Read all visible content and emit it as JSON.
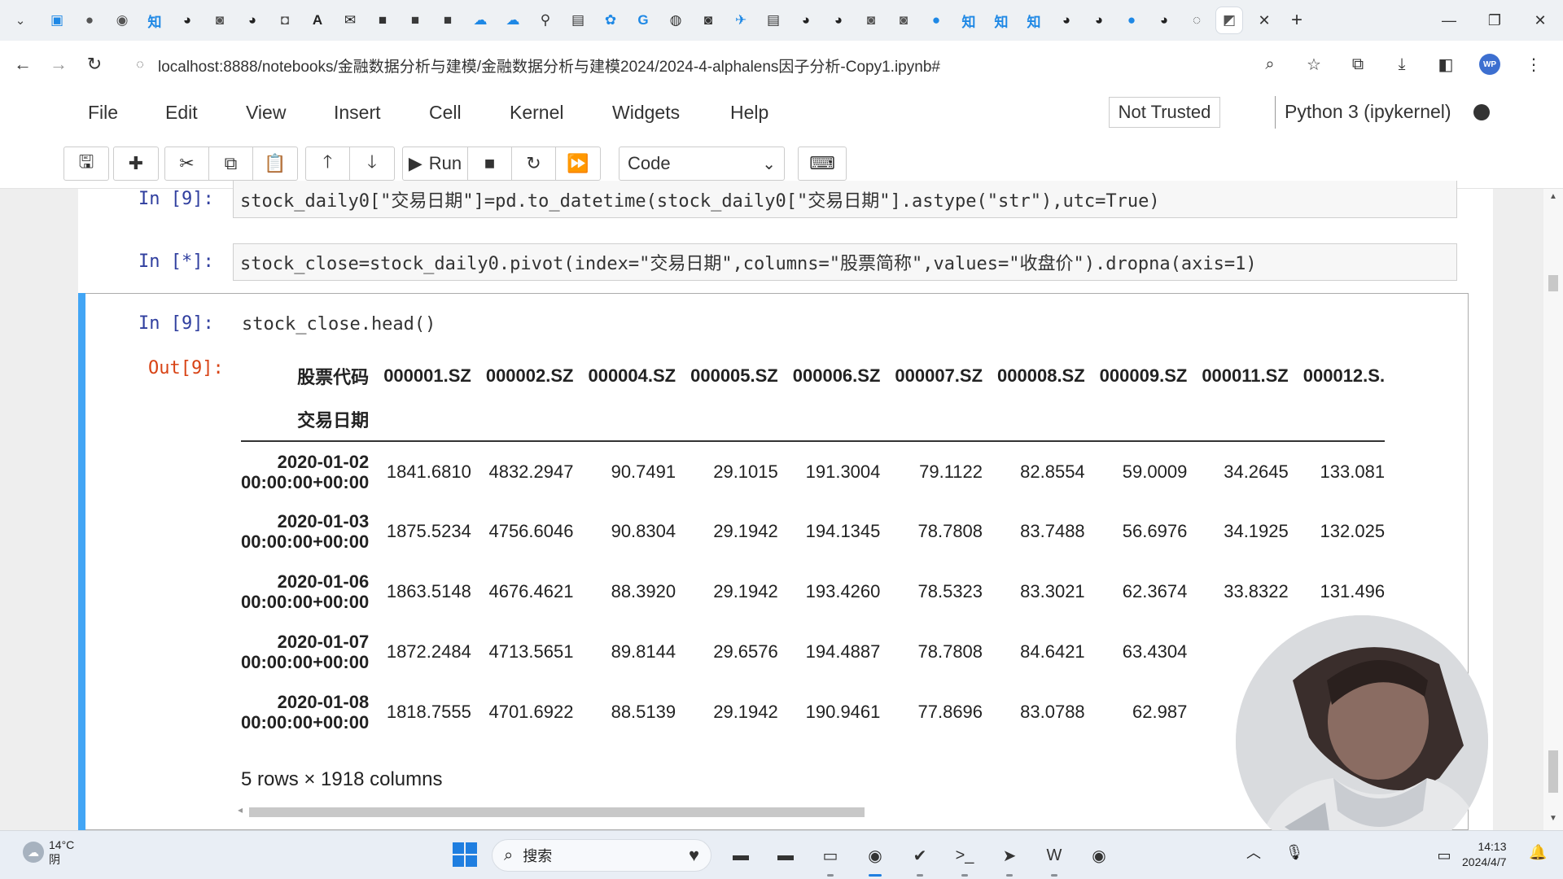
{
  "browser": {
    "tabs": [
      {
        "icon": "bilibili-icon",
        "glyph": "▣",
        "color": "#1e88e5"
      },
      {
        "icon": "chat-bubble-icon",
        "glyph": "●",
        "color": "#555555"
      },
      {
        "icon": "chrome-icon",
        "glyph": "◉",
        "color": "#555555"
      },
      {
        "icon": "zhihu-icon",
        "glyph": "知",
        "color": "#1e88e5"
      },
      {
        "icon": "github-icon",
        "glyph": "◕",
        "color": "#222222"
      },
      {
        "icon": "page-icon",
        "glyph": "◙",
        "color": "#555555"
      },
      {
        "icon": "github-icon",
        "glyph": "◕",
        "color": "#222222"
      },
      {
        "icon": "app-icon",
        "glyph": "◘",
        "color": "#555555"
      },
      {
        "icon": "font-icon",
        "glyph": "A",
        "color": "#222222"
      },
      {
        "icon": "mail-icon",
        "glyph": "✉",
        "color": "#222222"
      },
      {
        "icon": "tds-icon",
        "glyph": "■",
        "color": "#333333"
      },
      {
        "icon": "dark-square-icon",
        "glyph": "■",
        "color": "#3a3a3a"
      },
      {
        "icon": "dark-square-icon",
        "glyph": "■",
        "color": "#3a3a3a"
      },
      {
        "icon": "cloud-icon",
        "glyph": "☁",
        "color": "#1e88e5"
      },
      {
        "icon": "cloud-icon",
        "glyph": "☁",
        "color": "#1e88e5"
      },
      {
        "icon": "pin-icon",
        "glyph": "⚲",
        "color": "#333333"
      },
      {
        "icon": "book-icon",
        "glyph": "▤",
        "color": "#333333"
      },
      {
        "icon": "paw-icon",
        "glyph": "✿",
        "color": "#1e88e5"
      },
      {
        "icon": "google-icon",
        "glyph": "G",
        "color": "#1e88e5"
      },
      {
        "icon": "globe-icon",
        "glyph": "◍",
        "color": "#333333"
      },
      {
        "icon": "page-icon",
        "glyph": "◙",
        "color": "#333333"
      },
      {
        "icon": "bird-icon",
        "glyph": "✈",
        "color": "#1e88e5"
      },
      {
        "icon": "book-icon",
        "glyph": "▤",
        "color": "#333333"
      },
      {
        "icon": "github-icon",
        "glyph": "◕",
        "color": "#222222"
      },
      {
        "icon": "github-icon",
        "glyph": "◕",
        "color": "#222222"
      },
      {
        "icon": "page-icon",
        "glyph": "◙",
        "color": "#555555"
      },
      {
        "icon": "page-icon",
        "glyph": "◙",
        "color": "#555555"
      },
      {
        "icon": "blue-circle-icon",
        "glyph": "●",
        "color": "#1e88e5"
      },
      {
        "icon": "zhihu-icon",
        "glyph": "知",
        "color": "#1e88e5"
      },
      {
        "icon": "zhihu-icon",
        "glyph": "知",
        "color": "#1e88e5"
      },
      {
        "icon": "zhihu-icon",
        "glyph": "知",
        "color": "#1e88e5"
      },
      {
        "icon": "github-icon",
        "glyph": "◕",
        "color": "#222222"
      },
      {
        "icon": "github-icon",
        "glyph": "◕",
        "color": "#222222"
      },
      {
        "icon": "blue-circle-icon",
        "glyph": "●",
        "color": "#1e88e5"
      },
      {
        "icon": "github-icon",
        "glyph": "◕",
        "color": "#222222"
      },
      {
        "icon": "loading-icon",
        "glyph": "◌",
        "color": "#555555"
      },
      {
        "icon": "jupyter-icon",
        "glyph": "◩",
        "color": "#555555",
        "active": true
      }
    ],
    "url": "localhost:8888/notebooks/金融数据分析与建模/金融数据分析与建模2024/2024-4-alphalens因子分析-Copy1.ipynb#",
    "profile_initials": "WP"
  },
  "jupyter": {
    "menu": [
      "File",
      "Edit",
      "View",
      "Insert",
      "Cell",
      "Kernel",
      "Widgets",
      "Help"
    ],
    "not_trusted": "Not Trusted",
    "kernel": "Python 3 (ipykernel)",
    "toolbar": {
      "run_label": "Run",
      "cell_type": "Code"
    },
    "cells": [
      {
        "prompt": "In  [9]:",
        "code": "stock_daily0[\"交易日期\"]=pd.to_datetime(stock_daily0[\"交易日期\"].astype(\"str\"),utc=True)"
      },
      {
        "prompt": "In  [*]:",
        "code": "stock_close=stock_daily0.pivot(index=\"交易日期\",columns=\"股票简称\",values=\"收盘价\").dropna(axis=1)"
      },
      {
        "prompt": "In  [9]:",
        "code": "stock_close.head()"
      }
    ],
    "output": {
      "prompt": "Out[9]:",
      "columns_name": "股票代码",
      "index_name": "交易日期",
      "columns": [
        "000001.SZ",
        "000002.SZ",
        "000004.SZ",
        "000005.SZ",
        "000006.SZ",
        "000007.SZ",
        "000008.SZ",
        "000009.SZ",
        "000011.SZ",
        "000012.S."
      ],
      "rows": [
        {
          "date": "2020-01-02",
          "time": "00:00:00+00:00",
          "values": [
            "1841.6810",
            "4832.2947",
            "90.7491",
            "29.1015",
            "191.3004",
            "79.1122",
            "82.8554",
            "59.0009",
            "34.2645",
            "133.081"
          ]
        },
        {
          "date": "2020-01-03",
          "time": "00:00:00+00:00",
          "values": [
            "1875.5234",
            "4756.6046",
            "90.8304",
            "29.1942",
            "194.1345",
            "78.7808",
            "83.7488",
            "56.6976",
            "34.1925",
            "132.025"
          ]
        },
        {
          "date": "2020-01-06",
          "time": "00:00:00+00:00",
          "values": [
            "1863.5148",
            "4676.4621",
            "88.3920",
            "29.1942",
            "193.4260",
            "78.5323",
            "83.3021",
            "62.3674",
            "33.8322",
            "131.496"
          ]
        },
        {
          "date": "2020-01-07",
          "time": "00:00:00+00:00",
          "values": [
            "1872.2484",
            "4713.5651",
            "89.8144",
            "29.6576",
            "194.4887",
            "78.7808",
            "84.6421",
            "63.4304",
            "",
            ""
          ]
        },
        {
          "date": "2020-01-08",
          "time": "00:00:00+00:00",
          "values": [
            "1818.7555",
            "4701.6922",
            "88.5139",
            "29.1942",
            "190.9461",
            "77.8696",
            "83.0788",
            "62.987",
            "",
            ""
          ]
        }
      ],
      "shape": "5 rows × 1918 columns"
    }
  },
  "taskbar": {
    "weather_temp": "14°C",
    "weather_desc": "阴",
    "search_label": "搜索",
    "apps": [
      {
        "icon": "folder-dark-icon",
        "glyph": "▬",
        "running": false
      },
      {
        "icon": "window-dark-icon",
        "glyph": "▬",
        "running": false
      },
      {
        "icon": "file-explorer-icon",
        "glyph": "▭",
        "running": true
      },
      {
        "icon": "chrome-icon",
        "glyph": "◉",
        "running": true,
        "active": true
      },
      {
        "icon": "vscode-check-icon",
        "glyph": "✔",
        "running": true
      },
      {
        "icon": "terminal-icon",
        "glyph": ">_",
        "running": true
      },
      {
        "icon": "arrow-app-icon",
        "glyph": "➤",
        "running": true
      },
      {
        "icon": "wps-icon",
        "glyph": "W",
        "running": true
      },
      {
        "icon": "record-icon",
        "glyph": "◉",
        "running": false
      }
    ],
    "time": "14:13",
    "date": "2024/4/7"
  }
}
